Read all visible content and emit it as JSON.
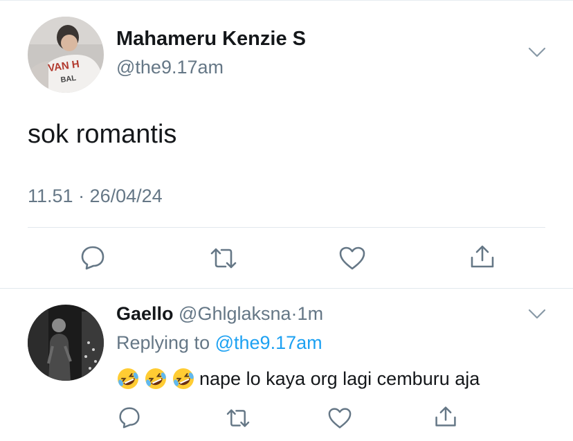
{
  "main_tweet": {
    "author_name": "Mahameru Kenzie S",
    "handle": "@the9.17am",
    "avatar_text_line1": "VAN H",
    "avatar_text_line2": "BAL",
    "text": "sok romantis",
    "timestamp": "11.51 · 26/04/24",
    "actions": [
      "reply-icon",
      "retweet-icon",
      "like-icon",
      "share-icon"
    ]
  },
  "reply": {
    "author_name": "Gaello",
    "handle": "@Ghlglaksna",
    "separator": "·",
    "time": "1m",
    "replying_prefix": "Replying to",
    "replying_handle": "@the9.17am",
    "emojis": [
      "rofl-emoji",
      "rofl-emoji",
      "rofl-emoji"
    ],
    "text": "nape lo kaya org lagi cemburu aja",
    "actions": [
      "reply-icon",
      "retweet-icon",
      "like-icon",
      "share-icon"
    ]
  },
  "colors": {
    "text": "#14171a",
    "secondary": "#657786",
    "link": "#1da1f2",
    "divider": "#e1e8ed",
    "icon": "#657786"
  }
}
